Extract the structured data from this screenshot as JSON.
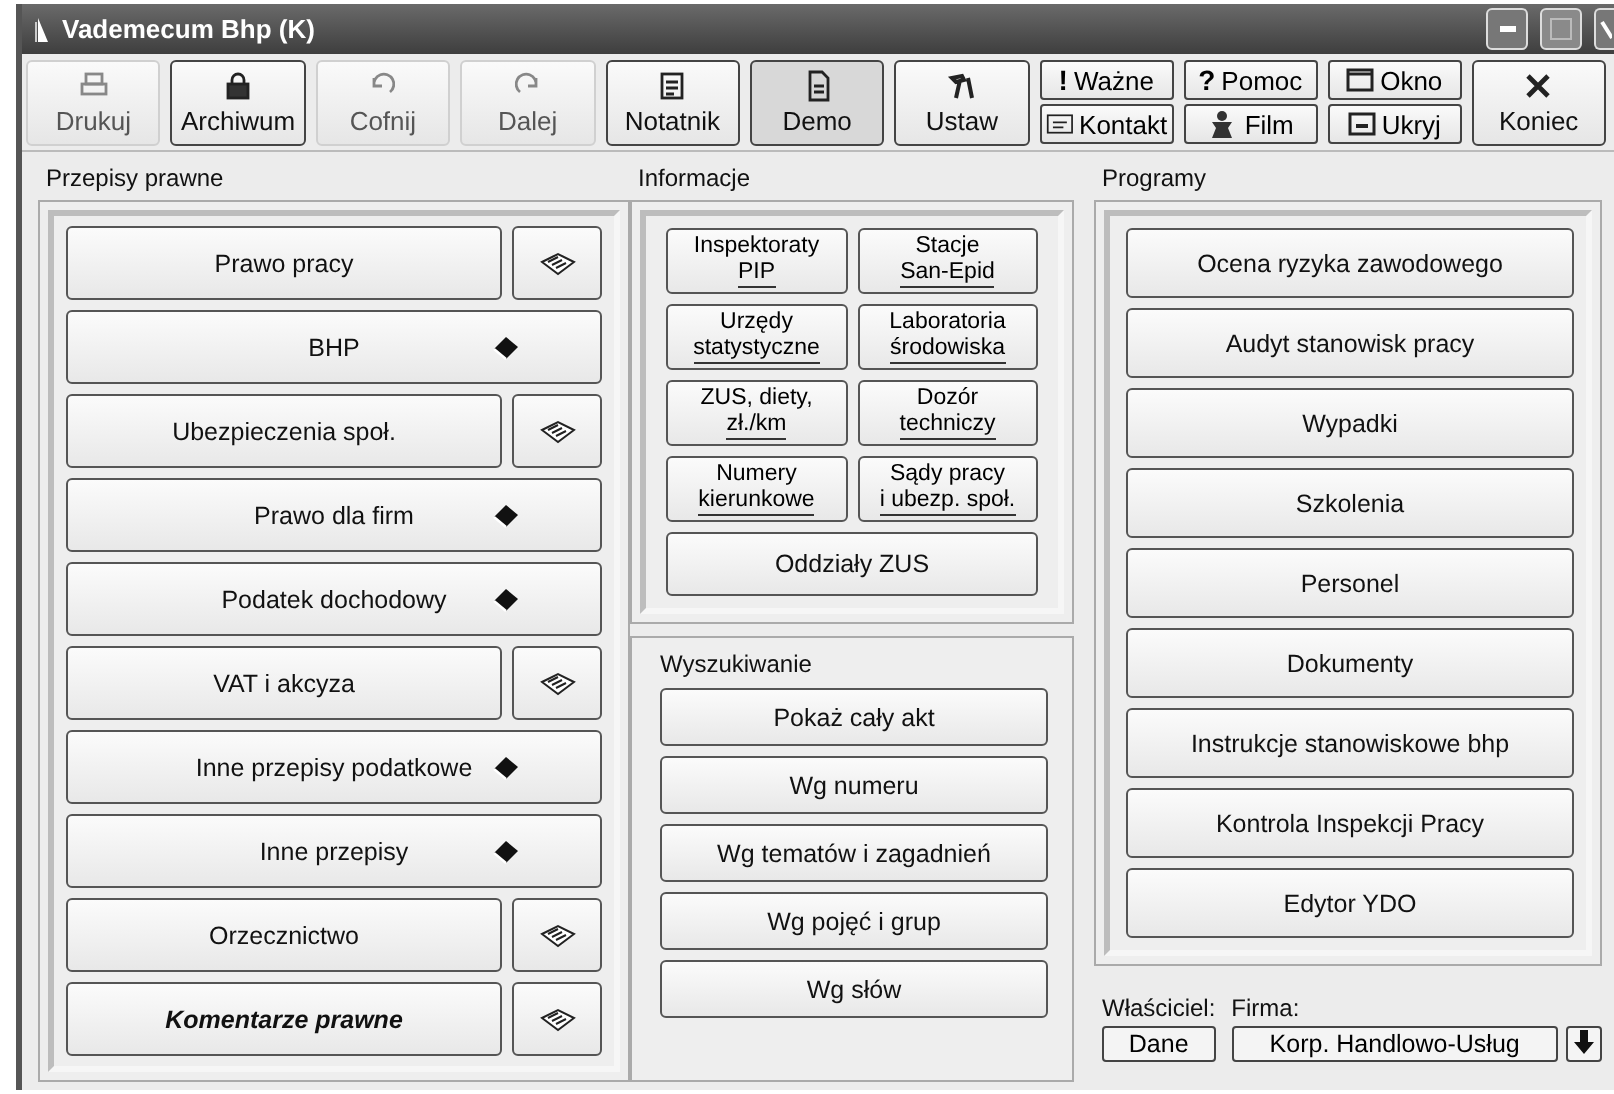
{
  "window": {
    "title": "Vademecum Bhp (K)"
  },
  "toolbar": [
    {
      "kind": "large",
      "label": "Drukuj",
      "disabled": true,
      "selected": false
    },
    {
      "kind": "large",
      "label": "Archiwum",
      "disabled": false,
      "selected": false
    },
    {
      "kind": "large",
      "label": "Cofnij",
      "disabled": true,
      "selected": false
    },
    {
      "kind": "large",
      "label": "Dalej",
      "disabled": true,
      "selected": false
    },
    {
      "kind": "large",
      "label": "Notatnik",
      "disabled": false,
      "selected": false
    },
    {
      "kind": "large",
      "label": "Demo",
      "disabled": false,
      "selected": true
    },
    {
      "kind": "large",
      "label": "Ustaw",
      "disabled": false,
      "selected": false
    },
    {
      "kind": "pair",
      "items": [
        {
          "glyph": "!",
          "label": "Ważne"
        },
        {
          "label": "Kontakt"
        }
      ]
    },
    {
      "kind": "pair",
      "items": [
        {
          "glyph": "?",
          "label": "Pomoc"
        },
        {
          "label": "Film"
        }
      ]
    },
    {
      "kind": "pair",
      "items": [
        {
          "label": "Okno"
        },
        {
          "label": "Ukryj"
        }
      ]
    },
    {
      "kind": "large",
      "label": "Koniec",
      "disabled": false,
      "selected": false
    }
  ],
  "przepisy": {
    "title": "Przepisy prawne",
    "items": [
      {
        "label": "Prawo pracy",
        "kind": "split",
        "emphasized": false
      },
      {
        "label": "BHP",
        "kind": "single",
        "emphasized": false
      },
      {
        "label": "Ubezpieczenia społ.",
        "kind": "split",
        "emphasized": false
      },
      {
        "label": "Prawo dla firm",
        "kind": "single",
        "emphasized": false
      },
      {
        "label": "Podatek dochodowy",
        "kind": "single",
        "emphasized": false
      },
      {
        "label": "VAT i akcyza",
        "kind": "split",
        "emphasized": false
      },
      {
        "label": "Inne przepisy podatkowe",
        "kind": "single",
        "emphasized": false
      },
      {
        "label": "Inne przepisy",
        "kind": "single",
        "emphasized": false
      },
      {
        "label": "Orzecznictwo",
        "kind": "split",
        "emphasized": false
      },
      {
        "label": "Komentarze prawne",
        "kind": "split",
        "emphasized": true
      }
    ]
  },
  "informacje": {
    "title": "Informacje",
    "items": [
      {
        "lines": [
          "Inspektoraty",
          "PIP"
        ]
      },
      {
        "lines": [
          "Stacje",
          "San-Epid"
        ]
      },
      {
        "lines": [
          "Urzędy",
          "statystyczne"
        ]
      },
      {
        "lines": [
          "Laboratoria",
          "środowiska"
        ]
      },
      {
        "lines": [
          "ZUS, diety,",
          "zł./km"
        ]
      },
      {
        "lines": [
          "Dozór",
          "techniczy"
        ]
      },
      {
        "lines": [
          "Numery",
          "kierunkowe"
        ]
      },
      {
        "lines": [
          "Sądy pracy",
          "i ubezp. społ."
        ]
      }
    ],
    "wide": "Oddziały ZUS"
  },
  "wyszukiwanie": {
    "title": "Wyszukiwanie",
    "items": [
      "Pokaż cały akt",
      "Wg numeru",
      "Wg tematów i zagadnień",
      "Wg pojęć i grup",
      "Wg słów"
    ]
  },
  "programy": {
    "title": "Programy",
    "items": [
      "Ocena ryzyka zawodowego",
      "Audyt stanowisk pracy",
      "Wypadki",
      "Szkolenia",
      "Personel",
      "Dokumenty",
      "Instrukcje stanowiskowe bhp",
      "Kontrola Inspekcji Pracy",
      "Edytor YDO"
    ]
  },
  "owner": {
    "owner_label": "Właściciel:",
    "firm_label": "Firma:",
    "owner_button": "Dane",
    "firm_button": "Korp. Handlowo-Usług"
  }
}
